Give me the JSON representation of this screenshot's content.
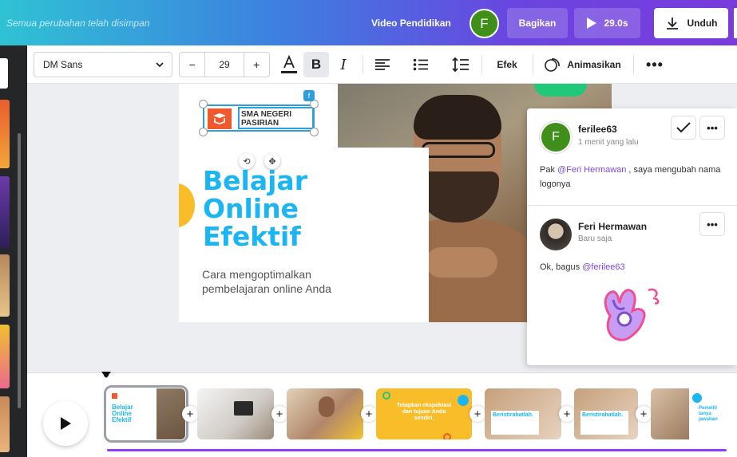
{
  "header": {
    "saved_status": "Semua perubahan telah disimpan",
    "doc_title": "Video Pendidikan",
    "user_initial": "F",
    "share_label": "Bagikan",
    "duration_label": "29.0s",
    "download_label": "Unduh"
  },
  "toolbar": {
    "font_family": "DM Sans",
    "font_size": "29",
    "minus": "−",
    "plus": "+",
    "effects_label": "Efek",
    "animate_label": "Animasikan"
  },
  "slide": {
    "logo_text": "SMA NEGERI PASIRIAN",
    "headline_1": "Belajar",
    "headline_2": "Online",
    "headline_3": "Efektif",
    "subtitle": "Cara mengoptimalkan pembelajaran online Anda",
    "badge": "f"
  },
  "comments": [
    {
      "author": "ferilee63",
      "initial": "F",
      "time": "1 menit yang lalu",
      "prefix": "Pak ",
      "mention": "@Feri Hermawan",
      "suffix": " , saya mengubah nama logonya"
    },
    {
      "author": "Feri Hermawan",
      "time": "Baru saja",
      "prefix": "Ok, bagus ",
      "mention": "@ferilee63",
      "suffix": ""
    }
  ],
  "timeline": {
    "scene1_title": "Belajar Online Efektif",
    "scene4_text": "Tetapkan ekspektasi dan tujuan Anda sendiri.",
    "scene5_text": "Beristirahatlah.",
    "scene6_text": "Beristirahatlah.",
    "scene7_text": "Pemeliti tanya jawaban"
  },
  "colors": {
    "accent": "#8b3dff",
    "headline": "#1bb6f2",
    "mention": "#7d4bd8",
    "avatar_green": "#3f8f1a"
  }
}
